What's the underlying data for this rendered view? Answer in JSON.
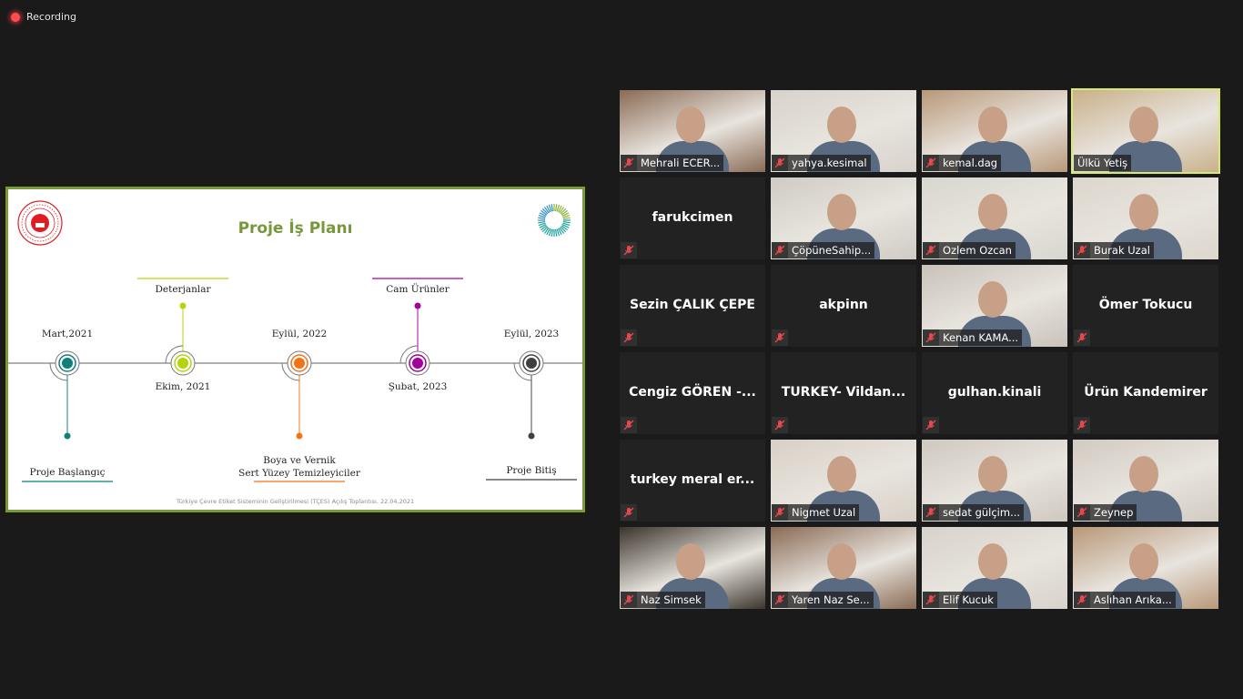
{
  "recording": {
    "label": "Recording",
    "indicator_color": "#ff4d4d"
  },
  "slide": {
    "title": "Proje İş Planı",
    "title_color": "#77983a",
    "border_color": "#7a9b35",
    "footer": "Türkiye Çevre Etiket Sisteminin Geliştirilmesi (TÇES) Açılış Toplantısı, 22.04.2021",
    "timeline": [
      {
        "date": "Mart,2021",
        "event": "Proje Başlangıç",
        "color": "#0f7f7a",
        "event_side": "below"
      },
      {
        "date": "Ekim, 2021",
        "event": "Deterjanlar",
        "color": "#b5d40a",
        "event_side": "above"
      },
      {
        "date": "Eylül, 2022",
        "event": "Boya ve Vernik",
        "event2": "Sert Yüzey Temizleyiciler",
        "color": "#f47216",
        "event_side": "below"
      },
      {
        "date": "Şubat, 2023",
        "event": "Cam Ürünler",
        "color": "#a3009e",
        "event_side": "above"
      },
      {
        "date": "Eylül, 2023",
        "event": "Proje Bitiş",
        "color": "#404040",
        "event_side": "below"
      }
    ]
  },
  "participants": [
    {
      "name": "Mehrali ECER...",
      "video": true,
      "muted": true,
      "active": false
    },
    {
      "name": "yahya.kesimal",
      "video": true,
      "muted": true,
      "active": false
    },
    {
      "name": "kemal.dag",
      "video": true,
      "muted": true,
      "active": false
    },
    {
      "name": "Ülkü Yetiş",
      "video": true,
      "muted": false,
      "active": true
    },
    {
      "name": "farukcimen",
      "video": false,
      "muted": true,
      "active": false
    },
    {
      "name": "ÇöpüneSahip...",
      "video": true,
      "muted": true,
      "active": false
    },
    {
      "name": "Ozlem Ozcan",
      "video": true,
      "muted": true,
      "active": false
    },
    {
      "name": "Burak Uzal",
      "video": true,
      "muted": true,
      "active": false
    },
    {
      "name": "Sezin ÇALIK ÇEPE",
      "video": false,
      "muted": true,
      "active": false
    },
    {
      "name": "akpinn",
      "video": false,
      "muted": true,
      "active": false
    },
    {
      "name": "Kenan KAMA...",
      "video": true,
      "muted": true,
      "active": false
    },
    {
      "name": "Ömer Tokucu",
      "video": false,
      "muted": true,
      "active": false
    },
    {
      "name": "Cengiz GÖREN -...",
      "video": false,
      "muted": true,
      "active": false
    },
    {
      "name": "TURKEY- Vildan...",
      "video": false,
      "muted": true,
      "active": false
    },
    {
      "name": "gulhan.kinali",
      "video": false,
      "muted": true,
      "active": false
    },
    {
      "name": "Ürün Kandemirer",
      "video": false,
      "muted": true,
      "active": false
    },
    {
      "name": "turkey meral er...",
      "video": false,
      "muted": true,
      "active": false
    },
    {
      "name": "Nigmet Uzal",
      "video": true,
      "muted": true,
      "active": false
    },
    {
      "name": "sedat gülçim...",
      "video": true,
      "muted": true,
      "active": false
    },
    {
      "name": "Zeynep",
      "video": true,
      "muted": true,
      "active": false
    },
    {
      "name": "Naz Simsek",
      "video": true,
      "muted": true,
      "active": false
    },
    {
      "name": "Yaren Naz Se...",
      "video": true,
      "muted": true,
      "active": false
    },
    {
      "name": "Elif Kucuk",
      "video": true,
      "muted": true,
      "active": false
    },
    {
      "name": "Aslıhan Arıka...",
      "video": true,
      "muted": true,
      "active": false
    }
  ],
  "colors": {
    "muted_icon": "#e8474c",
    "active_border": "#d8ea6a",
    "tile_bg": "#222222"
  }
}
